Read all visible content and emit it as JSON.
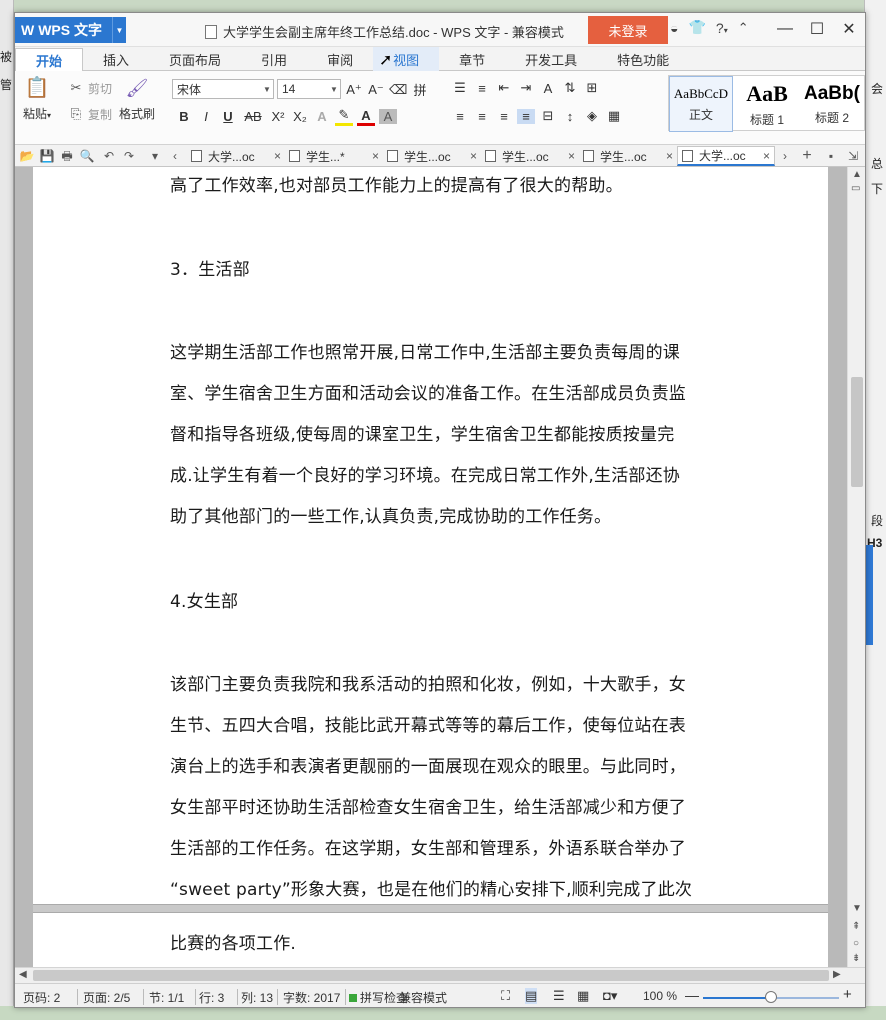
{
  "background": {
    "left_chars": [
      "被",
      "管"
    ],
    "right_chars": [
      "会",
      "总",
      "下",
      "段",
      "H3"
    ]
  },
  "titlebar": {
    "app_name": "WPS 文字",
    "document_title": "大学学生会副主席年终工作总结.doc - WPS 文字 - 兼容模式",
    "login_label": "未登录",
    "help_label": "?",
    "accent": "#2b77d0",
    "login_color": "#e5603f"
  },
  "ribbon_tabs": [
    "开始",
    "插入",
    "页面布局",
    "引用",
    "审阅",
    "视图",
    "章节",
    "开发工具",
    "特色功能"
  ],
  "ribbon": {
    "paste": "粘贴",
    "cut": "剪切",
    "copy": "复制",
    "format_painter": "格式刷",
    "font_name": "宋体",
    "font_size": "14",
    "styles": [
      {
        "preview": "AaBbCcD",
        "name": "正文"
      },
      {
        "preview": "AaB",
        "name": "标题 1"
      },
      {
        "preview": "AaBb(",
        "name": "标题 2"
      }
    ]
  },
  "doc_tabs": [
    "大学...oc",
    "学生...*",
    "学生...oc",
    "学生...oc",
    "学生...oc",
    "大学...oc"
  ],
  "document": {
    "lines": [
      "高了工作效率,也对部员工作能力上的提高有了很大的帮助。",
      "3．生活部",
      "这学期生活部工作也照常开展,日常工作中,生活部主要负责每周的课",
      "室、学生宿舍卫生方面和活动会议的准备工作。在生活部成员负责监",
      "督和指导各班级,使每周的课室卫生，学生宿舍卫生都能按质按量完",
      "成.让学生有着一个良好的学习环境。在完成日常工作外,生活部还协",
      "助了其他部门的一些工作,认真负责,完成协助的工作任务。",
      "4.女生部",
      "该部门主要负责我院和我系活动的拍照和化妆，例如，十大歌手，女",
      "生节、五四大合唱，技能比武开幕式等等的幕后工作，使每位站在表",
      "演台上的选手和表演者更靓丽的一面展现在观众的眼里。与此同时，",
      "女生部平时还协助生活部检查女生宿舍卫生，给生活部减少和方便了",
      "生活部的工作任务。在这学期，女生部和管理系，外语系联合举办了",
      "“sweet party”形象大赛，也是在他们的精心安排下,顺利完成了此次",
      "比赛的各项工作."
    ]
  },
  "statusbar": {
    "page_code": "页码: 2",
    "page": "页面: 2/5",
    "section": "节: 1/1",
    "row": "行: 3",
    "col": "列: 13",
    "word_count": "字数: 2017",
    "spell_check": "拼写检查",
    "compat_mode": "兼容模式",
    "zoom": "100 %",
    "zoom_level": 0.5
  }
}
